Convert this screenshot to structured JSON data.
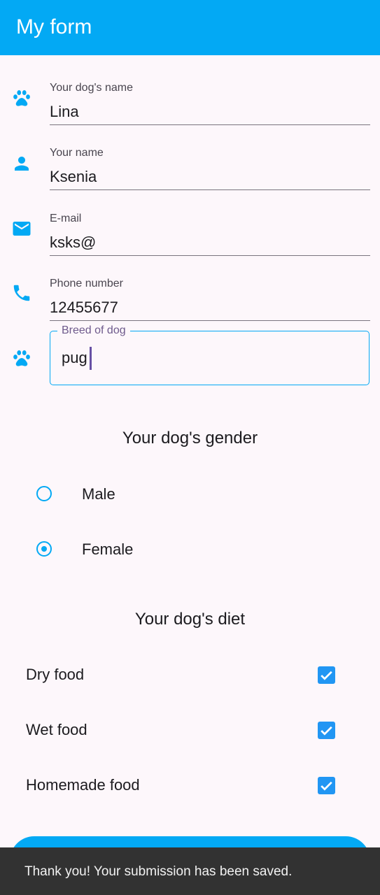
{
  "appbar": {
    "title": "My form"
  },
  "form": {
    "dog_name": {
      "label": "Your dog's name",
      "value": "Lina",
      "icon": "paw-icon"
    },
    "owner_name": {
      "label": "Your name",
      "value": "Ksenia",
      "icon": "person-icon"
    },
    "email": {
      "label": "E-mail",
      "value": "ksks@",
      "icon": "mail-icon"
    },
    "phone": {
      "label": "Phone number",
      "value": "12455677",
      "icon": "phone-icon"
    },
    "breed": {
      "label": "Breed of dog",
      "value": "pug",
      "icon": "paw-icon"
    }
  },
  "gender": {
    "title": "Your dog's gender",
    "options": [
      {
        "label": "Male",
        "selected": false
      },
      {
        "label": "Female",
        "selected": true
      }
    ]
  },
  "diet": {
    "title": "Your dog's diet",
    "options": [
      {
        "label": "Dry food",
        "checked": true
      },
      {
        "label": "Wet food",
        "checked": true
      },
      {
        "label": "Homemade food",
        "checked": true
      }
    ]
  },
  "snackbar": {
    "message": "Thank you! Your submission has been saved."
  },
  "colors": {
    "accent": "#03a9f4",
    "checkbox": "#2196f3",
    "background": "#fdf7fb",
    "snackbar": "#323232"
  }
}
